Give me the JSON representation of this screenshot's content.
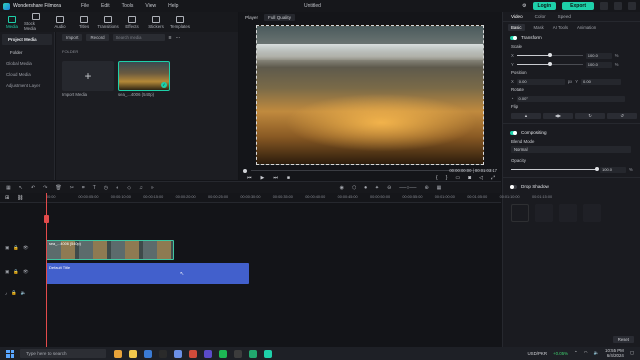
{
  "app": {
    "name": "Wondershare Filmora",
    "menu": [
      "File",
      "Edit",
      "Tools",
      "View",
      "Help"
    ],
    "title": "Untitled",
    "login": "Login",
    "export": "Export"
  },
  "toolbar": {
    "items": [
      {
        "label": "Media",
        "icon": "media-icon",
        "active": true
      },
      {
        "label": "Stock Media",
        "icon": "stock-media-icon"
      },
      {
        "label": "Audio",
        "icon": "audio-icon"
      },
      {
        "label": "Titles",
        "icon": "titles-icon"
      },
      {
        "label": "Transitions",
        "icon": "transitions-icon"
      },
      {
        "label": "Effects",
        "icon": "effects-icon"
      },
      {
        "label": "Stickers",
        "icon": "stickers-icon"
      },
      {
        "label": "Templates",
        "icon": "templates-icon"
      }
    ]
  },
  "sidebar": {
    "header": "Project Media",
    "items": [
      "Folder",
      "Global Media",
      "Cloud Media",
      "Adjustment Layer"
    ]
  },
  "media": {
    "import": "Import",
    "record": "Record",
    "search_placeholder": "Search media",
    "folder_label": "FOLDER",
    "import_caption": "Import Media",
    "clip_caption": "sea_...4006 (540p)"
  },
  "player": {
    "label": "Player",
    "quality": "Full Quality",
    "current_time": "00:00:00:00",
    "duration": "00:01:03:17"
  },
  "properties": {
    "tabs": [
      "Video",
      "Color",
      "Speed"
    ],
    "subtabs": [
      "Basic",
      "Mask",
      "AI Tools",
      "Animation"
    ],
    "transform": "Transform",
    "scale": {
      "label": "Scale",
      "x_label": "X",
      "y_label": "Y",
      "x_value": "100.0",
      "y_value": "100.0",
      "unit": "%",
      "level": 0.5
    },
    "position": {
      "label": "Position",
      "x_label": "X",
      "x_value": "0.00",
      "y_label": "Y",
      "y_value": "0.00",
      "unit": "px"
    },
    "rotate": {
      "label": "Rotate",
      "value": "0.00°"
    },
    "flip": "Flip",
    "compositing": "Compositing",
    "blend_mode": {
      "label": "Blend Mode",
      "value": "Normal"
    },
    "opacity": {
      "label": "Opacity",
      "value": "100.0",
      "unit": "%",
      "level": 1.0
    },
    "drop_shadow": "Drop Shadow",
    "reset": "Reset"
  },
  "timeline": {
    "ticks": [
      "00:00",
      "00:00:05:00",
      "00:00:10:00",
      "00:00:15:00",
      "00:00:20:00",
      "00:00:25:00",
      "00:00:30:00",
      "00:00:35:00",
      "00:00:40:00",
      "00:00:45:00",
      "00:00:50:00",
      "00:00:55:00",
      "00:01:00:00",
      "00:01:05:00",
      "00:01:10:00",
      "00:01:15:00"
    ],
    "video_clip": "sea_...4006 (540p)",
    "title_clip": "Default Title"
  },
  "taskbar": {
    "search_placeholder": "Type here to search",
    "currency": "USD/PKR",
    "currency_change": "+0.05%",
    "time": "10:55 PM",
    "date": "6/4/2024",
    "apps": [
      "#e8a33a",
      "#f2c94c",
      "#3a7bd5",
      "#2a2a2a",
      "#6b8fe6",
      "#d04b3a",
      "#5b4bc9",
      "#1db954",
      "#3c3c3c",
      "#21a96f",
      "#1ed0a9"
    ]
  }
}
